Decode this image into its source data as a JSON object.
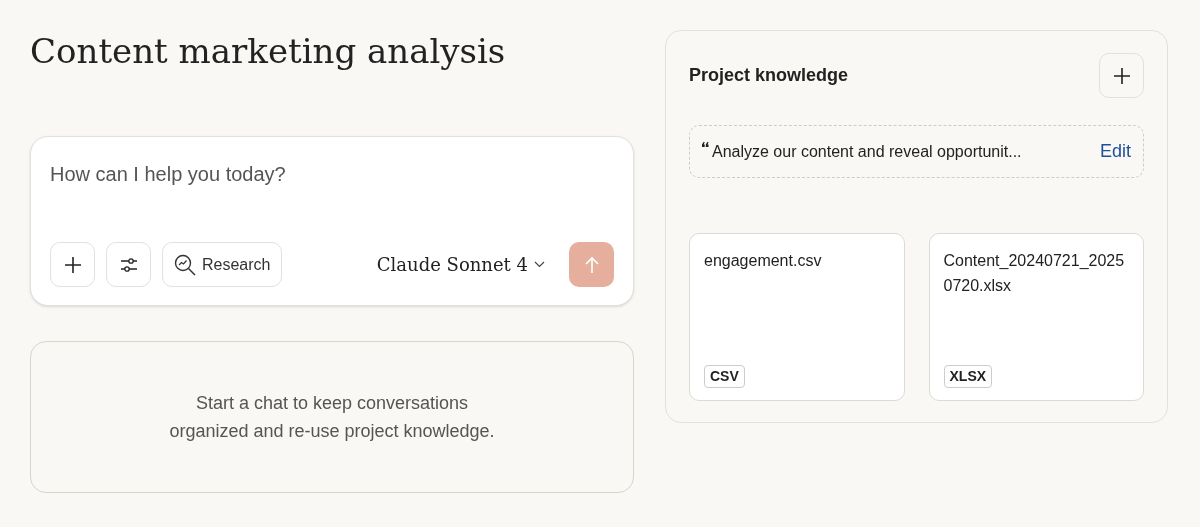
{
  "page_title": "Content marketing analysis",
  "composer": {
    "placeholder": "How can I help you today?",
    "research_label": "Research",
    "model": "Claude Sonnet 4"
  },
  "empty_state": "Start a chat to keep conversations organized and re-use project knowledge.",
  "knowledge": {
    "title": "Project knowledge",
    "instructions": "Analyze our content and reveal opportunit...",
    "edit_label": "Edit",
    "files": [
      {
        "name": "engagement.csv",
        "type": "CSV"
      },
      {
        "name": "Content_20240721_20250720.xlsx",
        "type": "XLSX"
      }
    ]
  }
}
